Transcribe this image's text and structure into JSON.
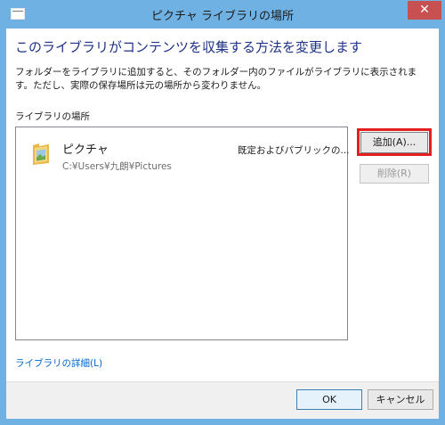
{
  "window": {
    "title": "ピクチャ ライブラリの場所",
    "close_label": "✕"
  },
  "dialog": {
    "heading": "このライブラリがコンテンツを収集する方法を変更します",
    "description": "フォルダーをライブラリに追加すると、そのフォルダー内のファイルがライブラリに表示されます。ただし、実際の保存場所は元の場所から変わりません。",
    "section_label": "ライブラリの場所"
  },
  "locations": [
    {
      "name": "ピクチャ",
      "path": "C:¥Users¥九朗¥Pictures",
      "status": "既定およびパブリックの..."
    }
  ],
  "buttons": {
    "add": "追加(A)...",
    "remove": "削除(R)",
    "ok": "OK",
    "cancel": "キャンセル"
  },
  "links": {
    "details": "ライブラリの詳細(L)"
  },
  "colors": {
    "title_bar": "#6fb1e3",
    "close_button": "#c75050",
    "heading": "#1e3287",
    "highlight": "#e21f1f",
    "link": "#0066cc"
  },
  "icons": {
    "app": "window-icon",
    "folder": "pictures-folder-icon",
    "close": "close-icon"
  }
}
